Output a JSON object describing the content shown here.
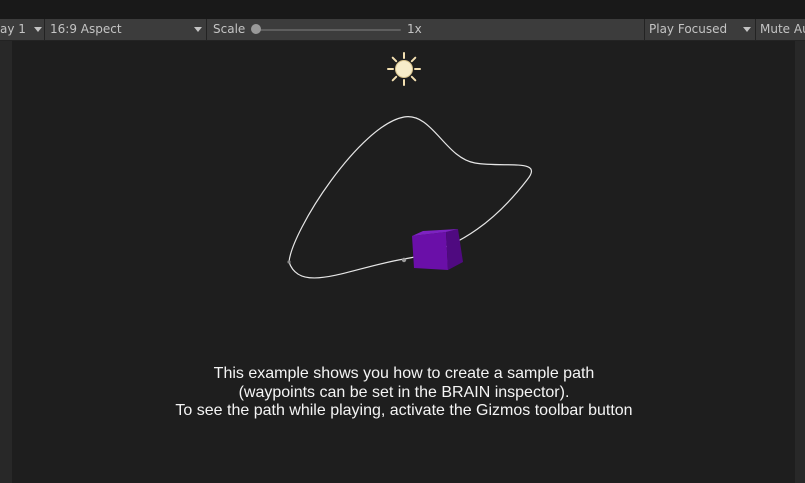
{
  "toolbar": {
    "display_label": "ay 1",
    "aspect_label": "16:9 Aspect",
    "scale_label": "Scale",
    "scale": 0.0,
    "scale_value": "1x",
    "play_mode_label": "Play Focused",
    "mute_label": "Mute Au"
  },
  "scene": {
    "info_lines": [
      "This example shows you how to create a sample path",
      "(waypoints can be set in the BRAIN inspector).",
      "To see the path while playing, activate the Gizmos toolbar button"
    ],
    "sun_icon": "sun-icon",
    "cube_color": "#6a0fa8",
    "path_color": "#e6e6e6"
  }
}
